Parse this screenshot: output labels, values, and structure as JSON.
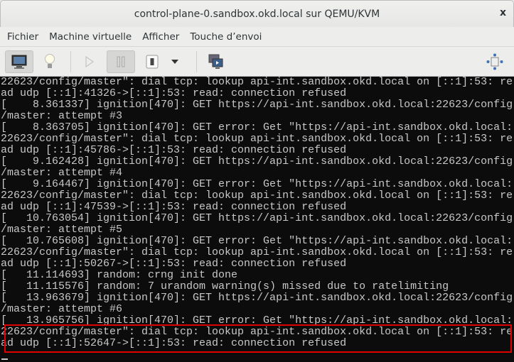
{
  "window": {
    "title": "control-plane-0.sandbox.okd.local sur QEMU/KVM",
    "close_label": "x"
  },
  "menu": [
    "Fichier",
    "Machine virtuelle",
    "Afficher",
    "Touche d’envoi"
  ],
  "toolbar": {
    "icons": [
      "console-icon",
      "details-lightbulb-icon",
      "run-icon",
      "pause-icon",
      "shutdown-icon",
      "shutdown-menu-chevron-icon",
      "snapshots-icon",
      "fullscreen-icon"
    ]
  },
  "console": {
    "lines": [
      "22623/config/master\": dial tcp: lookup api-int.sandbox.okd.local on [::1]:53: re",
      "ad udp [::1]:41326->[::1]:53: read: connection refused",
      "[    8.361337] ignition[470]: GET https://api-int.sandbox.okd.local:22623/config",
      "/master: attempt #3",
      "[    8.363705] ignition[470]: GET error: Get \"https://api-int.sandbox.okd.local:",
      "22623/config/master\": dial tcp: lookup api-int.sandbox.okd.local on [::1]:53: re",
      "ad udp [::1]:45786->[::1]:53: read: connection refused",
      "[    9.162428] ignition[470]: GET https://api-int.sandbox.okd.local:22623/config",
      "/master: attempt #4",
      "[    9.164467] ignition[470]: GET error: Get \"https://api-int.sandbox.okd.local:",
      "22623/config/master\": dial tcp: lookup api-int.sandbox.okd.local on [::1]:53: re",
      "ad udp [::1]:47539->[::1]:53: read: connection refused",
      "[   10.763054] ignition[470]: GET https://api-int.sandbox.okd.local:22623/config",
      "/master: attempt #5",
      "[   10.765608] ignition[470]: GET error: Get \"https://api-int.sandbox.okd.local:",
      "22623/config/master\": dial tcp: lookup api-int.sandbox.okd.local on [::1]:53: re",
      "ad udp [::1]:50267->[::1]:53: read: connection refused",
      "[   11.114693] random: crng init done",
      "[   11.115576] random: 7 urandom warning(s) missed due to ratelimiting",
      "[   13.963679] ignition[470]: GET https://api-int.sandbox.okd.local:22623/config",
      "/master: attempt #6",
      "[   13.965756] ignition[470]: GET error: Get \"https://api-int.sandbox.okd.local:",
      "22623/config/master\": dial tcp: lookup api-int.sandbox.okd.local on [::1]:53: re",
      "ad udp [::1]:52647->[::1]:53: read: connection refused"
    ]
  },
  "colors": {
    "highlight": "#e00000",
    "terminal_bg": "#0c0c0c",
    "terminal_fg": "#c8c8c8"
  }
}
